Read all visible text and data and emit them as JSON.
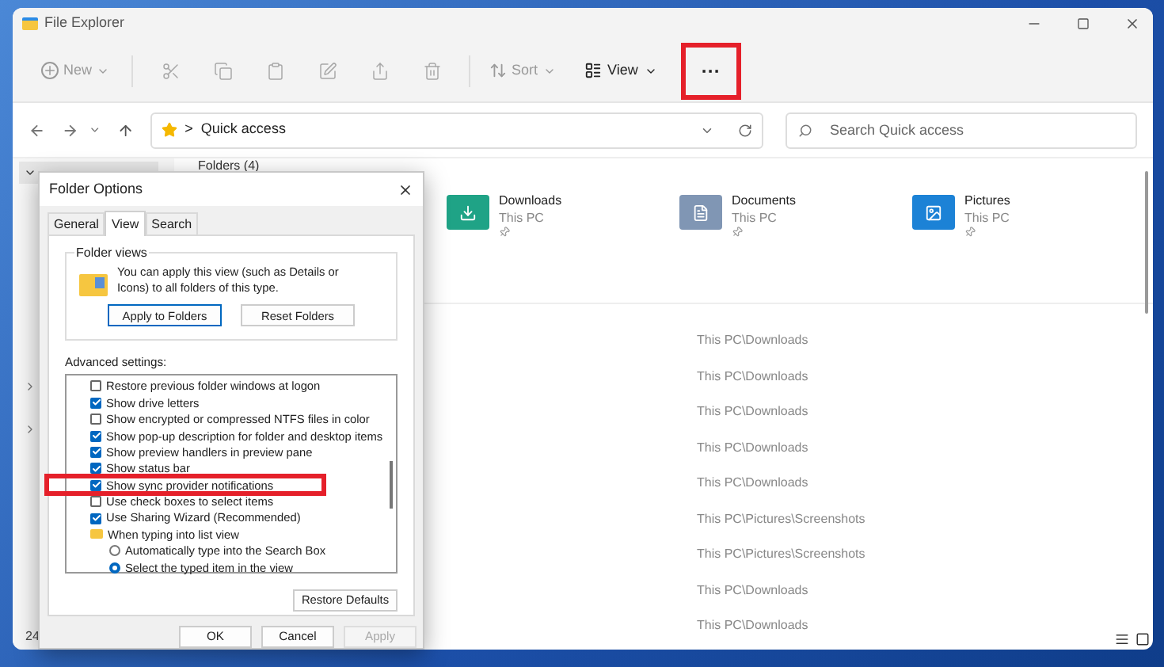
{
  "window": {
    "title": "File Explorer"
  },
  "toolbar": {
    "new_button": {
      "label": "New",
      "disabled": true
    },
    "icon_buttons": [
      {
        "kind": "cut",
        "disabled": true
      },
      {
        "kind": "copy",
        "disabled": true
      },
      {
        "kind": "paste",
        "disabled": true
      },
      {
        "kind": "rename",
        "disabled": true
      },
      {
        "kind": "share",
        "disabled": true
      },
      {
        "kind": "delete",
        "disabled": true
      }
    ],
    "sort_button": {
      "label": "Sort",
      "disabled": true
    },
    "view_button": {
      "label": "View",
      "disabled": false
    },
    "more_button": {
      "label": "···",
      "highlighted": true
    }
  },
  "address_bar": {
    "path_separator": ">",
    "location": "Quick access"
  },
  "search": {
    "placeholder": "Search Quick access"
  },
  "main": {
    "section_heading": "Folders (4)",
    "folders": [
      {
        "kind": "downloads",
        "name": "Downloads",
        "location": "This PC"
      },
      {
        "kind": "documents",
        "name": "Documents",
        "location": "This PC"
      },
      {
        "kind": "pictures",
        "name": "Pictures",
        "location": "This PC"
      }
    ],
    "recent_locations": [
      "This PC\\Downloads",
      "This PC\\Downloads",
      "This PC\\Downloads",
      "This PC\\Downloads",
      "This PC\\Downloads",
      "This PC\\Pictures\\Screenshots",
      "This PC\\Pictures\\Screenshots",
      "This PC\\Downloads",
      "This PC\\Downloads"
    ]
  },
  "status_bar": {
    "item_count": "24"
  },
  "dialog": {
    "title": "Folder Options",
    "tabs": [
      {
        "label": "General",
        "selected": false
      },
      {
        "label": "View",
        "selected": true
      },
      {
        "label": "Search",
        "selected": false
      }
    ],
    "folder_views": {
      "title": "Folder views",
      "description": "You can apply this view (such as Details or Icons) to all folders of this type.",
      "buttons": [
        "Apply to Folders",
        "Reset Folders"
      ]
    },
    "advanced_label": "Advanced settings:",
    "settings": [
      {
        "kind": "checkbox",
        "label": "Restore previous folder windows at logon",
        "checked": false
      },
      {
        "kind": "checkbox",
        "label": "Show drive letters",
        "checked": true
      },
      {
        "kind": "checkbox",
        "label": "Show encrypted or compressed NTFS files in color",
        "checked": false
      },
      {
        "kind": "checkbox",
        "label": "Show pop-up description for folder and desktop items",
        "checked": true
      },
      {
        "kind": "checkbox",
        "label": "Show preview handlers in preview pane",
        "checked": true
      },
      {
        "kind": "checkbox",
        "label": "Show status bar",
        "checked": true
      },
      {
        "kind": "checkbox",
        "label": "Show sync provider notifications",
        "checked": true,
        "highlighted": true
      },
      {
        "kind": "checkbox",
        "label": "Use check boxes to select items",
        "checked": false
      },
      {
        "kind": "checkbox",
        "label": "Use Sharing Wizard (Recommended)",
        "checked": true
      },
      {
        "kind": "group",
        "label": "When typing into list view",
        "children": [
          {
            "kind": "radio",
            "label": "Automatically type into the Search Box",
            "selected": false
          },
          {
            "kind": "radio",
            "label": "Select the typed item in the view",
            "selected": true
          }
        ]
      }
    ],
    "restore_button": "Restore Defaults",
    "buttons": [
      {
        "label": "OK",
        "disabled": false
      },
      {
        "label": "Cancel",
        "disabled": false
      },
      {
        "label": "Apply",
        "disabled": true
      }
    ]
  }
}
